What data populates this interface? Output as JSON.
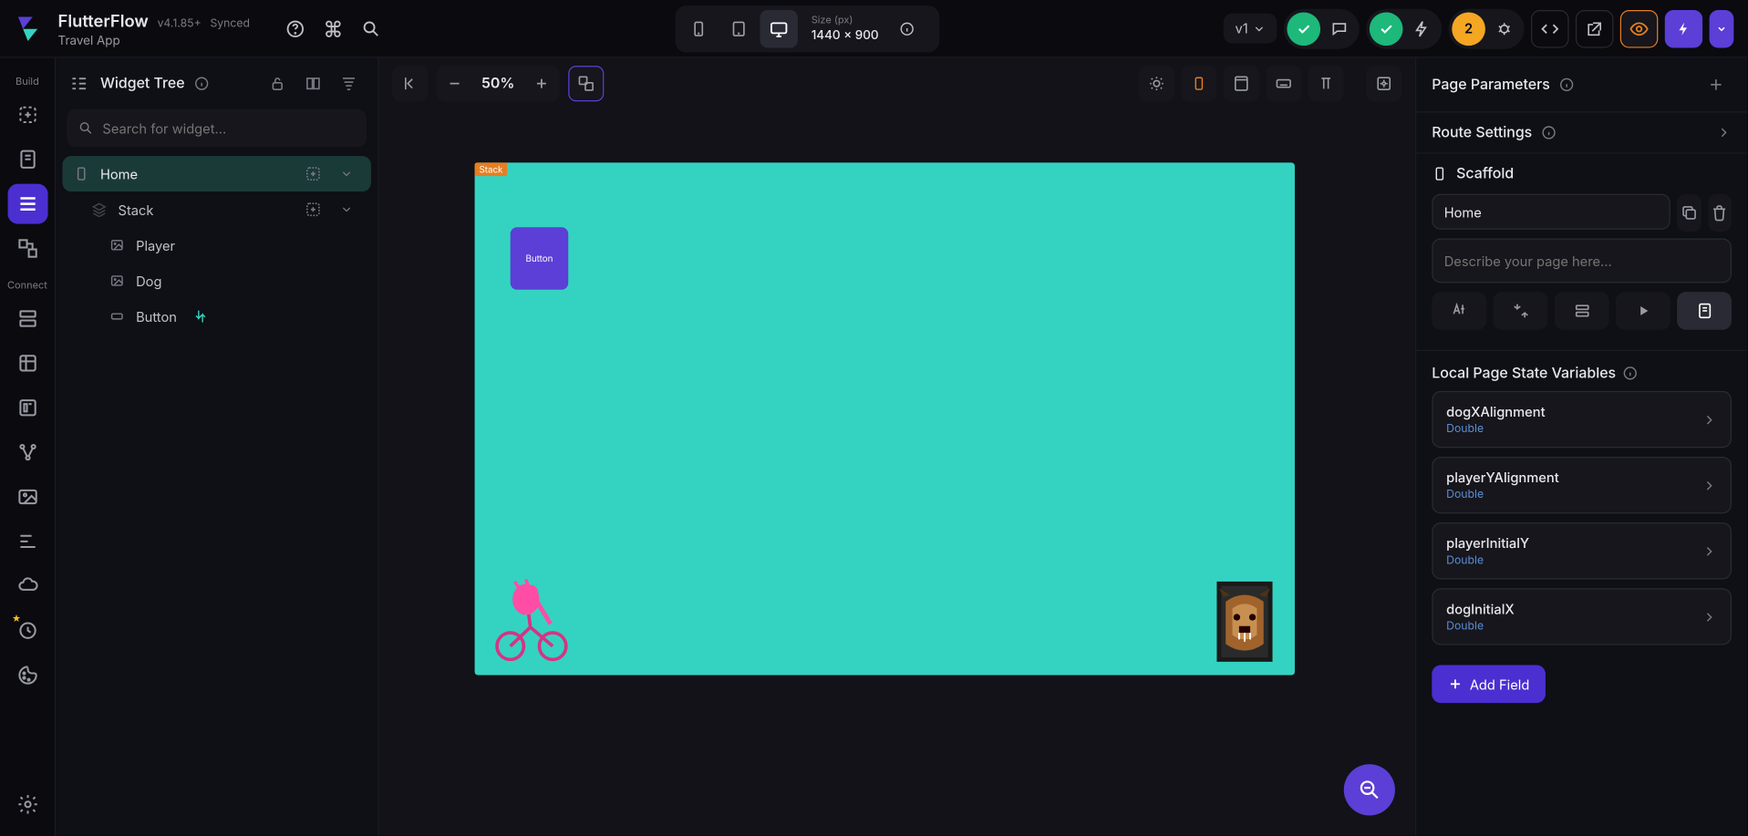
{
  "brand": {
    "name": "FlutterFlow",
    "version": "v4.1.85+",
    "sync": "Synced",
    "project": "Travel App"
  },
  "device": {
    "size_label": "Size (px)",
    "size_value": "1440 × 900"
  },
  "version_pill": "v1",
  "issues_count": "2",
  "rail": {
    "build": "Build",
    "connect": "Connect"
  },
  "widget_tree": {
    "title": "Widget Tree",
    "search_placeholder": "Search for widget...",
    "items": [
      {
        "name": "Home",
        "icon": "phone",
        "indent": 0,
        "selected": true,
        "add": true,
        "menu": true
      },
      {
        "name": "Stack",
        "icon": "layers",
        "indent": 1,
        "selected": false,
        "add": true,
        "menu": true
      },
      {
        "name": "Player",
        "icon": "image",
        "indent": 2,
        "selected": false
      },
      {
        "name": "Dog",
        "icon": "image",
        "indent": 2,
        "selected": false
      },
      {
        "name": "Button",
        "icon": "btn",
        "indent": 2,
        "selected": false,
        "action": true
      }
    ]
  },
  "canvas": {
    "zoom": "50%",
    "stack_tag": "Stack",
    "button_label": "Button"
  },
  "right": {
    "page_params": "Page Parameters",
    "route_settings": "Route Settings",
    "scaffold": "Scaffold",
    "page_name": "Home",
    "desc_placeholder": "Describe your page here...",
    "local_vars_title": "Local Page State Variables",
    "vars": [
      {
        "name": "dogXAlignment",
        "type": "Double"
      },
      {
        "name": "playerYAlignment",
        "type": "Double"
      },
      {
        "name": "playerInitialY",
        "type": "Double"
      },
      {
        "name": "dogInitialX",
        "type": "Double"
      }
    ],
    "add_field": "Add Field"
  }
}
